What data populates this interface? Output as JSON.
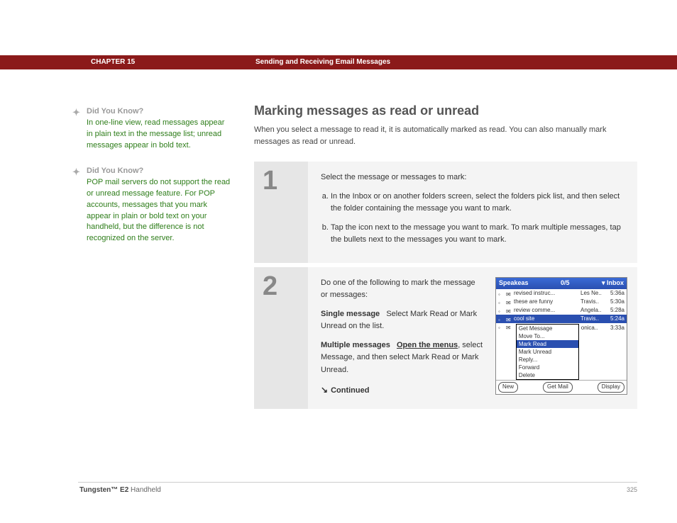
{
  "header": {
    "chapter": "CHAPTER 15",
    "title": "Sending and Receiving Email Messages"
  },
  "sidebar": {
    "tips": [
      {
        "head": "Did You Know?",
        "body": "In one-line view, read messages appear in plain text in the message list; unread messages appear in bold text."
      },
      {
        "head": "Did You Know?",
        "body": "POP mail servers do not support the read or unread message feature. For POP accounts, messages that you mark appear in plain or bold text on your handheld, but the difference is not recognized on the server."
      }
    ]
  },
  "main": {
    "heading": "Marking messages as read or unread",
    "intro": "When you select a message to read it, it is automatically marked as read. You can also manually mark messages as read or unread.",
    "step1": {
      "num": "1",
      "lead": "Select the message or messages to mark:",
      "a": "In the Inbox or on another folders screen, select the folders pick list, and then select the folder containing the message you want to mark.",
      "b": "Tap the icon next to the message you want to mark. To mark multiple messages, tap the bullets next to the messages you want to mark."
    },
    "step2": {
      "num": "2",
      "lead": "Do one of the following to mark the message or messages:",
      "single_label": "Single message",
      "single_body": "Select Mark Read or Mark Unread on the list.",
      "multi_label": "Multiple messages",
      "multi_link": "Open the menus",
      "multi_body": ", select Message, and then select Mark Read or Mark Unread.",
      "continued": "Continued"
    }
  },
  "screenshot": {
    "titlebar_left": "Speakeas",
    "titlebar_mid": "0/5",
    "titlebar_right": "▾ Inbox",
    "rows": [
      {
        "subj": "revised instruc...",
        "from": "Les Ne..",
        "time": "5:36a"
      },
      {
        "subj": "these are funny",
        "from": "Travis..",
        "time": "5:30a"
      },
      {
        "subj": "review comme...",
        "from": "Angela..",
        "time": "5:28a"
      },
      {
        "subj": "cool site",
        "from": "Travis..",
        "time": "5:24a"
      },
      {
        "subj": "",
        "from": "onica..",
        "time": "3:33a"
      }
    ],
    "menu": [
      "Get Message",
      "Move To...",
      "Mark Read",
      "Mark Unread",
      "Reply...",
      "Forward",
      "Delete"
    ],
    "menu_selected": "Mark Read",
    "buttons": [
      "New",
      "Get Mail",
      "Display"
    ]
  },
  "footer": {
    "product_bold": "Tungsten™ E2",
    "product_rest": " Handheld",
    "page": "325"
  }
}
